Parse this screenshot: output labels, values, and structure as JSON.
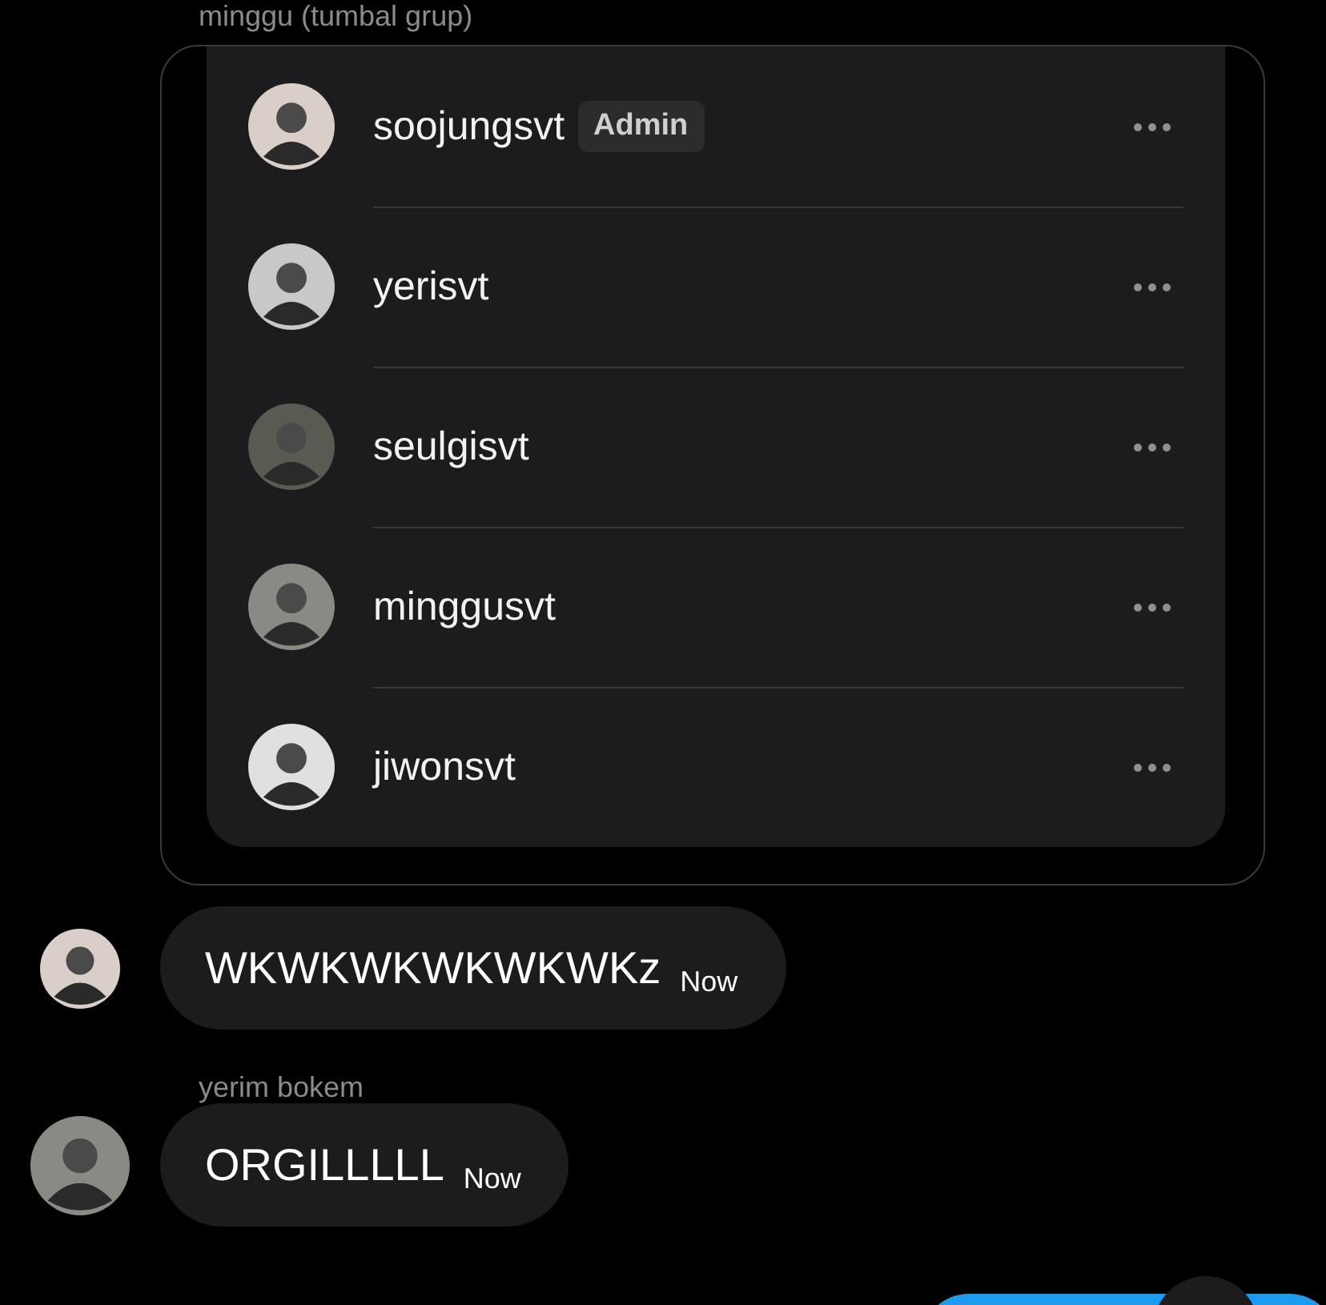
{
  "shared_group": {
    "sender": "minggu (tumbal grup)",
    "members": [
      {
        "name": "soojungsvt",
        "badge": "Admin"
      },
      {
        "name": "yerisvt"
      },
      {
        "name": "seulgisvt"
      },
      {
        "name": "minggusvt"
      },
      {
        "name": "jiwonsvt"
      }
    ]
  },
  "messages": [
    {
      "text": "WKWKWKWKWKWKz",
      "time": "Now"
    },
    {
      "sender": "yerim bokem",
      "text": "ORGILLLLL",
      "time": "Now"
    }
  ]
}
